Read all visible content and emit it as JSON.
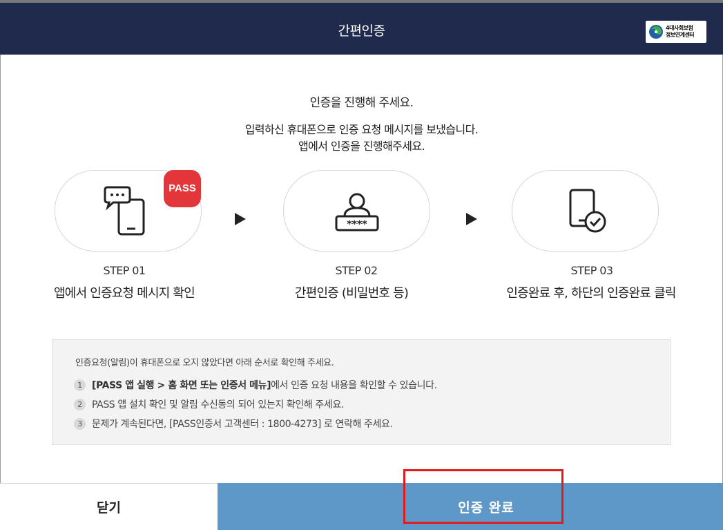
{
  "header": {
    "title": "간편인증",
    "logo_line1": "4대사회보험",
    "logo_line2": "정보연계센터"
  },
  "intro": {
    "line1": "인증을 진행해 주세요.",
    "line2": "입력하신 휴대폰으로 인증 요청 메시지를 보냈습니다.",
    "line3": "앱에서 인증을 진행해주세요."
  },
  "pass_badge": "PASS",
  "steps": [
    {
      "number": "STEP 01",
      "desc": "앱에서 인증요청 메시지 확인",
      "icon": "phone-message-icon"
    },
    {
      "number": "STEP 02",
      "desc": "간편인증 (비밀번호 등)",
      "icon": "password-user-icon"
    },
    {
      "number": "STEP 03",
      "desc": "인증완료 후, 하단의 인증완료 클릭",
      "icon": "phone-check-icon"
    }
  ],
  "notice": {
    "heading": "인증요청(알림)이 휴대폰으로 오지 않았다면 아래 순서로 확인해 주세요.",
    "items": [
      {
        "num": "1",
        "bold": "[PASS 앱 실행 > 홈 화면 또는 인증서 메뉴]",
        "text": " 에서 인증 요청 내용을 확인할 수 있습니다."
      },
      {
        "num": "2",
        "bold": "",
        "text": "PASS 앱 설치 확인 및 알림 수신동의 되어 있는지 확인해 주세요."
      },
      {
        "num": "3",
        "bold": "",
        "text": "문제가 계속된다면, [PASS인증서 고객센터 : 1800-4273] 로 연락해 주세요."
      }
    ]
  },
  "buttons": {
    "close": "닫기",
    "complete": "인증 완료"
  },
  "colors": {
    "header_bg": "#1f2a4c",
    "complete_bg": "#5e98c8",
    "pass_red": "#e2363a",
    "highlight": "#e01b1b"
  }
}
